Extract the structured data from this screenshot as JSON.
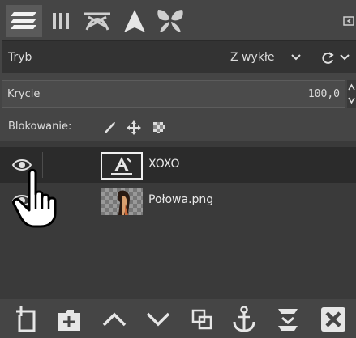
{
  "tabs": [
    {
      "icon": "layers-icon"
    },
    {
      "icon": "channels-icon"
    },
    {
      "icon": "paths-icon"
    },
    {
      "icon": "tool-options-icon"
    },
    {
      "icon": "brushes-icon"
    }
  ],
  "mode": {
    "label": "Tryb",
    "value": "Z wykłe"
  },
  "opacity": {
    "label": "Krycie",
    "value": "100,0",
    "fraction": 1.0
  },
  "lock": {
    "label": "Blokowanie:"
  },
  "layers": [
    {
      "name": "XOXO",
      "type": "text",
      "visible": true
    },
    {
      "name": "Połowa.png",
      "type": "image",
      "visible": true
    }
  ],
  "bottom_buttons": [
    "new-layer-icon",
    "new-layer-group-icon",
    "raise-layer-icon",
    "lower-layer-icon",
    "duplicate-layer-icon",
    "anchor-icon",
    "merge-down-icon",
    "delete-layer-icon"
  ],
  "colors": {
    "background": "#454545",
    "panel": "#333333",
    "selected_row": "#2b2b2b",
    "text": "#dcdcdc"
  }
}
